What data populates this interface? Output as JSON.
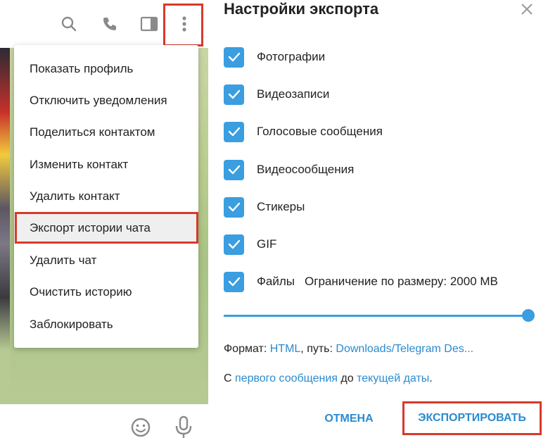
{
  "left": {
    "toolbar": {
      "icons": [
        "search-icon",
        "phone-icon",
        "sidebar-toggle-icon",
        "more-vertical-icon"
      ]
    },
    "menu": {
      "items": [
        {
          "label": "Показать профиль"
        },
        {
          "label": "Отключить уведомления"
        },
        {
          "label": "Поделиться контактом"
        },
        {
          "label": "Изменить контакт"
        },
        {
          "label": "Удалить контакт"
        },
        {
          "label": "Экспорт истории чата",
          "highlighted": true
        },
        {
          "label": "Удалить чат"
        },
        {
          "label": "Очистить историю"
        },
        {
          "label": "Заблокировать"
        }
      ]
    },
    "bottom": {
      "icons": [
        "emoji-icon",
        "microphone-icon"
      ]
    }
  },
  "dialog": {
    "title": "Настройки экспорта",
    "options": [
      {
        "label": "Фотографии",
        "checked": true
      },
      {
        "label": "Видеозаписи",
        "checked": true
      },
      {
        "label": "Голосовые сообщения",
        "checked": true
      },
      {
        "label": "Видеосообщения",
        "checked": true
      },
      {
        "label": "Стикеры",
        "checked": true
      },
      {
        "label": "GIF",
        "checked": true
      },
      {
        "label": "Файлы",
        "checked": true
      }
    ],
    "size_limit": "Ограничение по размеру: 2000 MB",
    "slider_value_fraction": 1.0,
    "format_line": {
      "prefix": "Формат: ",
      "format": "HTML",
      "path_prefix": ", путь: ",
      "path": "Downloads/Telegram Des..."
    },
    "range_line": {
      "prefix": "С ",
      "from": "первого сообщения",
      "middle": " до ",
      "to": "текущей даты",
      "suffix": "."
    },
    "cancel_label": "ОТМЕНА",
    "export_label": "ЭКСПОРТИРОВАТЬ"
  },
  "colors": {
    "accent": "#3a9ee0",
    "link": "#2a8bd0",
    "highlight_box": "#d63a2a"
  }
}
